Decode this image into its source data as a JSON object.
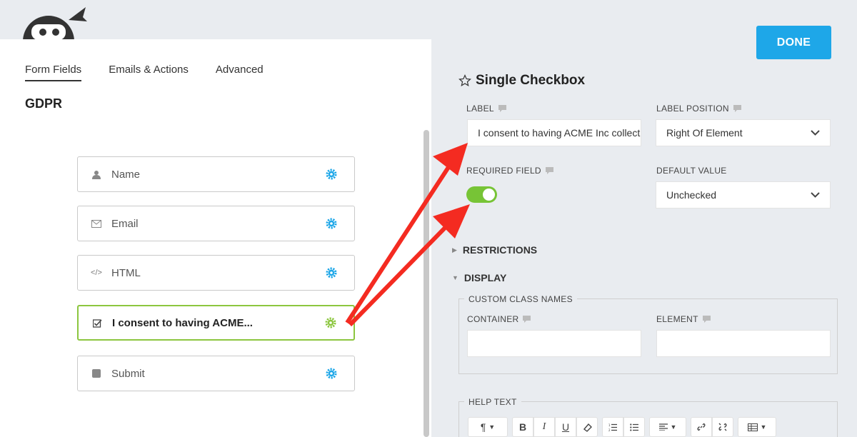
{
  "tabs": [
    {
      "label": "Form Fields",
      "active": true
    },
    {
      "label": "Emails & Actions",
      "active": false
    },
    {
      "label": "Advanced",
      "active": false
    }
  ],
  "form_title": "GDPR",
  "fields": [
    {
      "label": "Name",
      "icon": "user-icon"
    },
    {
      "label": "Email",
      "icon": "envelope-icon"
    },
    {
      "label": "HTML",
      "icon": "code-icon"
    },
    {
      "label": "I consent to having ACME...",
      "icon": "checkbox-icon",
      "active": true
    },
    {
      "label": "Submit",
      "icon": "square-icon"
    }
  ],
  "done_label": "DONE",
  "panel": {
    "title": "Single Checkbox",
    "label_label": "LABEL",
    "label_value": "I consent to having ACME Inc collect my name and email",
    "label_position_label": "LABEL POSITION",
    "label_position_value": "Right Of Element",
    "required_label": "REQUIRED FIELD",
    "required_on": true,
    "default_value_label": "DEFAULT VALUE",
    "default_value": "Unchecked",
    "restrictions": "RESTRICTIONS",
    "display": "DISPLAY",
    "custom_class": "CUSTOM CLASS NAMES",
    "container": "CONTAINER",
    "element": "ELEMENT",
    "help_text": "HELP TEXT"
  },
  "colors": {
    "accent": "#1ea7e8",
    "toggle_on": "#77c436",
    "active_border": "#8cc63f",
    "arrow": "#f42b21"
  }
}
